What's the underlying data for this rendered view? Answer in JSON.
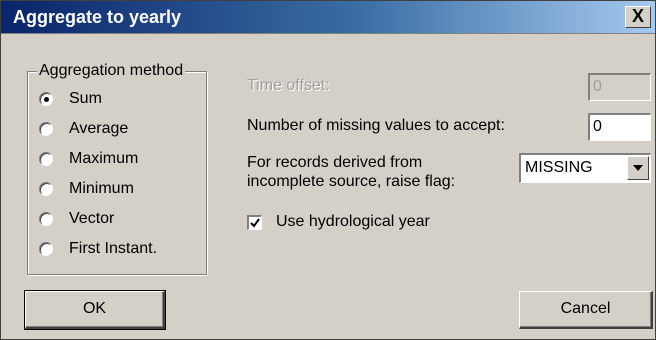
{
  "window": {
    "title": "Aggregate to yearly",
    "close_label": "X"
  },
  "aggregation": {
    "group_label": "Aggregation method",
    "options": [
      {
        "label": "Sum",
        "selected": true
      },
      {
        "label": "Average",
        "selected": false
      },
      {
        "label": "Maximum",
        "selected": false
      },
      {
        "label": "Minimum",
        "selected": false
      },
      {
        "label": "Vector",
        "selected": false
      },
      {
        "label": "First Instant.",
        "selected": false
      }
    ]
  },
  "time_offset": {
    "label": "Time offset:",
    "value": "0",
    "enabled": false
  },
  "missing_values": {
    "label": "Number of missing values to accept:",
    "value": "0"
  },
  "flag": {
    "label_line1": "For records derived from",
    "label_line2": "incomplete source, raise flag:",
    "selected": "MISSING"
  },
  "hydrological_year": {
    "label": "Use hydrological year",
    "checked": true
  },
  "buttons": {
    "ok": "OK",
    "cancel": "Cancel"
  }
}
